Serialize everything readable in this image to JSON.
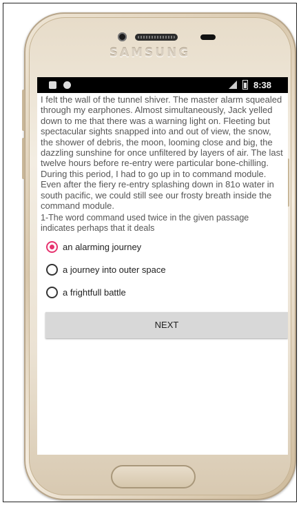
{
  "device": {
    "brand": "SAMSUNG"
  },
  "statusbar": {
    "time": "8:38",
    "icons": [
      "notification-icon",
      "alarm-icon",
      "signal-icon",
      "battery-icon"
    ]
  },
  "passage": {
    "text": "I felt the wall of the tunnel shiver. The master alarm squealed through my earphones. Almost simultaneously, Jack yelled down to me that there was a warning light on. Fleeting but spectacular sights snapped into and out of view, the snow, the shower of debris, the moon, looming close and big, the dazzling sunshine for once unfiltered by layers of air. The last twelve hours before re-entry were particular bone-chilling. During this period, I had to go up in to command module. Even after the fiery re-entry splashing down in 81o water in south pacific, we could still see our frosty breath inside the command module."
  },
  "question": {
    "text": "1-The word command used twice in the given passage indicates perhaps that it deals"
  },
  "options": [
    {
      "label": "an alarming journey",
      "selected": true
    },
    {
      "label": "a journey into outer space",
      "selected": false
    },
    {
      "label": "a frightfull battle",
      "selected": false
    }
  ],
  "next_button": {
    "label": "NEXT"
  },
  "colors": {
    "accent": "#e6336f",
    "statusbar": "#000000",
    "button": "#d8d8d8"
  }
}
